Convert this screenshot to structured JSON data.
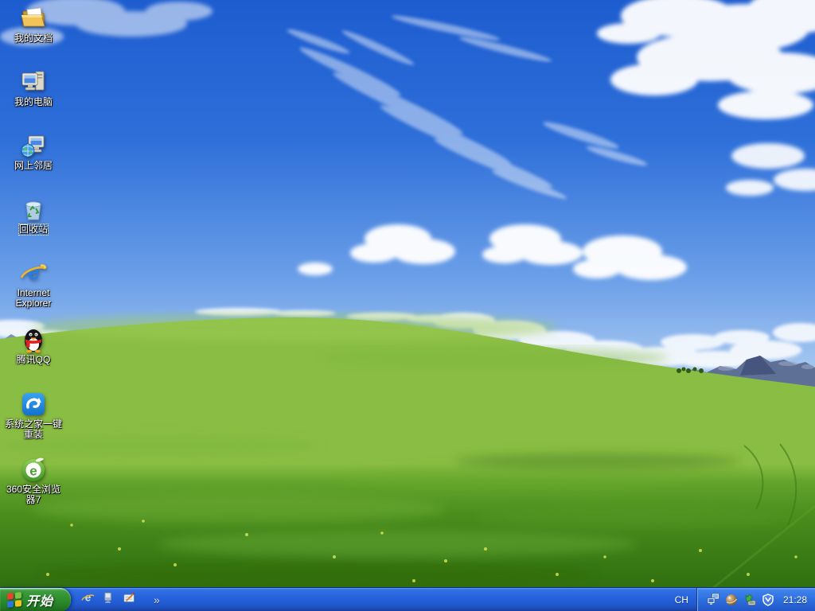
{
  "desktop": {
    "icons": [
      {
        "label": "我的文档",
        "icon": "my-documents-folder-icon",
        "selected": false
      },
      {
        "label": "我的电脑",
        "icon": "my-computer-icon",
        "selected": false
      },
      {
        "label": "网上邻居",
        "icon": "network-places-icon",
        "selected": false
      },
      {
        "label": "回收站",
        "icon": "recycle-bin-icon",
        "selected": true
      },
      {
        "label": "Internet Explorer",
        "icon": "internet-explorer-icon",
        "selected": false
      },
      {
        "label": "腾讯QQ",
        "icon": "qq-penguin-icon",
        "selected": false
      },
      {
        "label": "系统之家一键重装",
        "icon": "system-reinstall-icon",
        "selected": false
      },
      {
        "label": "360安全浏览器7",
        "icon": "360-browser-icon",
        "selected": false
      }
    ]
  },
  "taskbar": {
    "start_label": "开始",
    "quick_launch": {
      "overflow_chevron": "»",
      "icons": [
        "internet-explorer-icon",
        "monitor-icon",
        "show-desktop-icon"
      ]
    },
    "language_indicator": "CH",
    "tray": {
      "icons": [
        "network-icon",
        "globe-icon",
        "safely-remove-hardware-icon",
        "shield-icon"
      ],
      "clock": "21:28"
    }
  },
  "colors": {
    "taskbar_blue": "#245edb",
    "start_green": "#2f8f2f",
    "sky_top": "#1d5ccf",
    "grass_green": "#4f8f1f",
    "label_text": "#ffffff"
  }
}
